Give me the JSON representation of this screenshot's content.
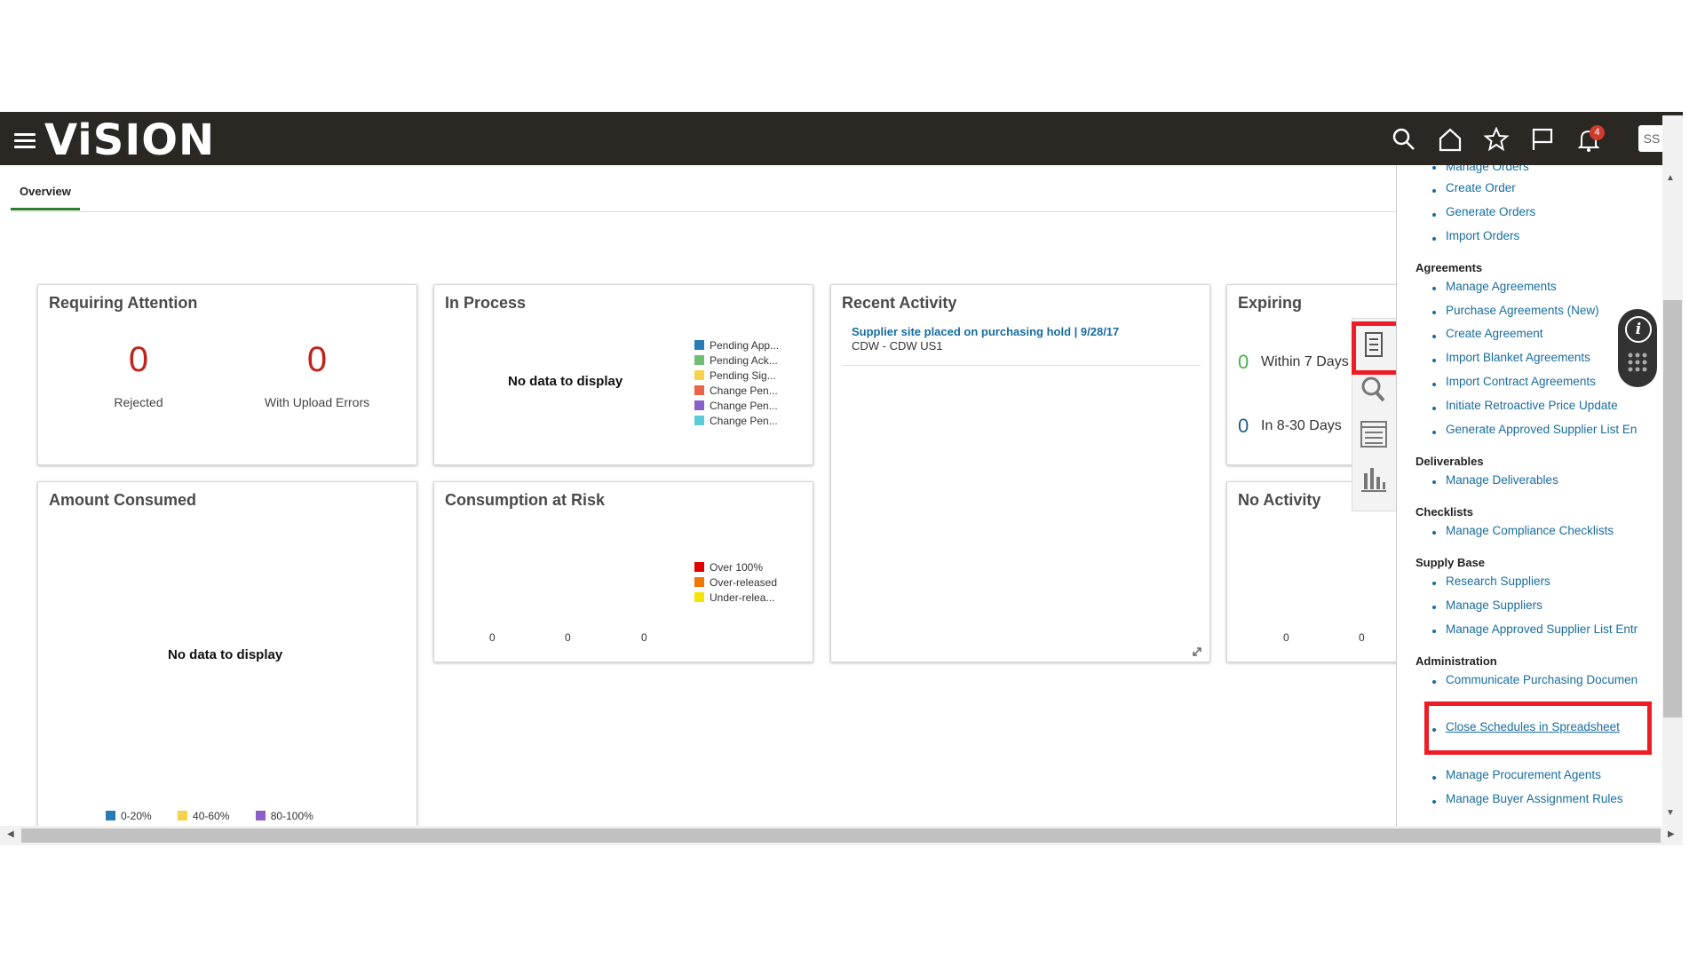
{
  "app": {
    "logo": "ViSION"
  },
  "header": {
    "icons": [
      "search-icon",
      "home-icon",
      "star-icon",
      "flag-icon",
      "bell-icon"
    ],
    "notification_count": "4",
    "user_initials": "SS"
  },
  "tabs": [
    {
      "label": "Overview"
    }
  ],
  "cards": {
    "requiring_attention": {
      "title": "Requiring Attention",
      "items": [
        {
          "value": "0",
          "label": "Rejected"
        },
        {
          "value": "0",
          "label": "With Upload Errors"
        }
      ]
    },
    "in_process": {
      "title": "In Process",
      "no_data": "No data to display",
      "legend": [
        {
          "label": "Pending App...",
          "color": "#2a7ab6"
        },
        {
          "label": "Pending Ack...",
          "color": "#6fbf73"
        },
        {
          "label": "Pending Sig...",
          "color": "#f5d24b"
        },
        {
          "label": "Change Pen...",
          "color": "#e8654a"
        },
        {
          "label": "Change Pen...",
          "color": "#8b5fc9"
        },
        {
          "label": "Change Pen...",
          "color": "#5ec9d6"
        }
      ]
    },
    "recent_activity": {
      "title": "Recent Activity",
      "link": "Supplier site placed on purchasing hold | 9/28/17",
      "subtext": "CDW - CDW US1"
    },
    "expiring": {
      "title": "Expiring",
      "rows": [
        {
          "value": "0",
          "label": "Within 7 Days",
          "color": "#4caf50"
        },
        {
          "value": "0",
          "label": "In 8-30 Days",
          "color": "#1f5f8b"
        }
      ]
    },
    "amount_consumed": {
      "title": "Amount Consumed",
      "no_data": "No data to display",
      "legend": [
        {
          "label": "0-20%",
          "color": "#2a7ab6"
        },
        {
          "label": "40-60%",
          "color": "#f5d24b"
        },
        {
          "label": "80-100%",
          "color": "#8b5fc9"
        }
      ]
    },
    "consumption_at_risk": {
      "title": "Consumption at Risk",
      "legend": [
        {
          "label": "Over 100%",
          "color": "#e00000"
        },
        {
          "label": "Over-released",
          "color": "#f07800"
        },
        {
          "label": "Under-relea...",
          "color": "#f5e400"
        }
      ],
      "axis_values": [
        "0",
        "0",
        "0"
      ]
    },
    "no_activity": {
      "title": "No Activity",
      "axis_values": [
        "0",
        "0"
      ]
    }
  },
  "tasks": {
    "partial_top": "Manage Orders",
    "orders": [
      "Create Order",
      "Generate Orders",
      "Import Orders"
    ],
    "agreements": {
      "heading": "Agreements",
      "items": [
        "Manage Agreements",
        "Purchase Agreements (New)",
        "Create Agreement",
        "Import Blanket Agreements",
        "Import Contract Agreements",
        "Initiate Retroactive Price Update",
        "Generate Approved Supplier List En"
      ]
    },
    "deliverables": {
      "heading": "Deliverables",
      "items": [
        "Manage Deliverables"
      ]
    },
    "checklists": {
      "heading": "Checklists",
      "items": [
        "Manage Compliance Checklists"
      ]
    },
    "supply_base": {
      "heading": "Supply Base",
      "items": [
        "Research Suppliers",
        "Manage Suppliers",
        "Manage Approved Supplier List Entr"
      ]
    },
    "administration": {
      "heading": "Administration",
      "items": [
        "Communicate Purchasing Documen",
        "Close Schedules in Spreadsheet",
        "Manage Procurement Agents",
        "Manage Buyer Assignment Rules"
      ]
    }
  },
  "side_icons": [
    "tasks-icon",
    "search-icon",
    "list-icon",
    "reports-icon"
  ]
}
